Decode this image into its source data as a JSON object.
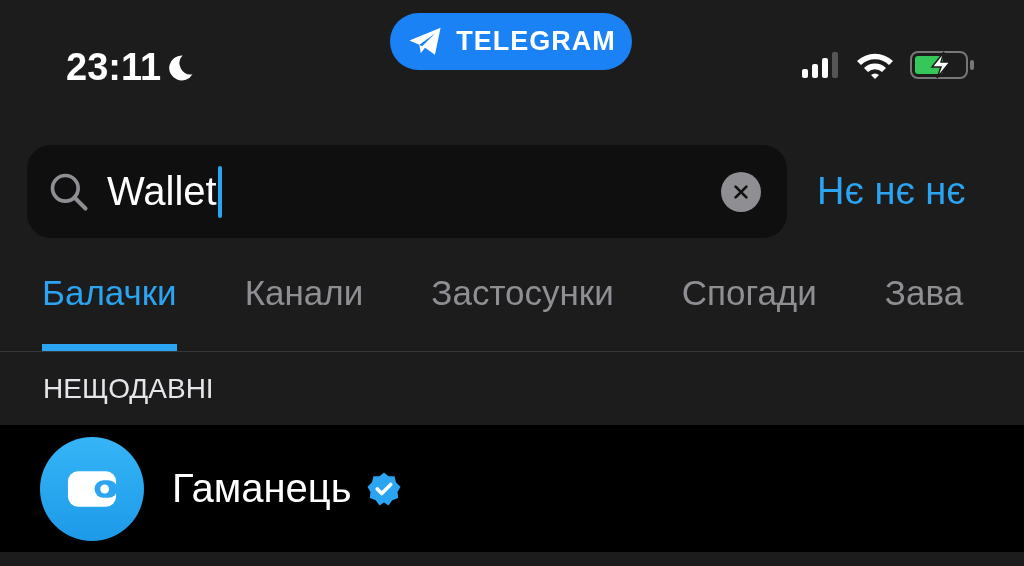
{
  "status_bar": {
    "time": "23:11",
    "app_pill": "TELEGRAM"
  },
  "search": {
    "value": "Wallet",
    "cancel": "Нє нє нє"
  },
  "tabs": [
    {
      "label": "Балачки",
      "selected": true
    },
    {
      "label": "Канали",
      "selected": false
    },
    {
      "label": "Застосунки",
      "selected": false
    },
    {
      "label": "Спогади",
      "selected": false
    },
    {
      "label": "Зава",
      "selected": false
    }
  ],
  "section_title": "НЕЩОДАВНІ",
  "results": [
    {
      "name": "Гаманець",
      "verified": true
    }
  ]
}
